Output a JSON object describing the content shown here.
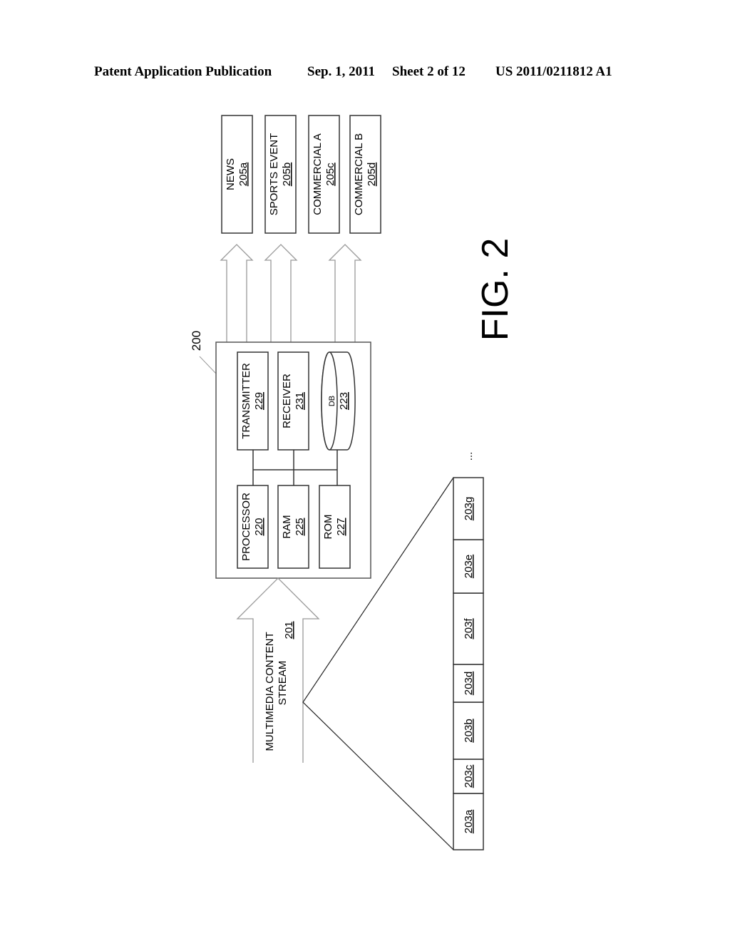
{
  "header": {
    "publication": "Patent Application Publication",
    "date": "Sep. 1, 2011",
    "sheet": "Sheet 2 of 12",
    "patent_number": "US 2011/0211812 A1"
  },
  "figure": {
    "label": "FIG. 2",
    "device": {
      "ref": "200",
      "components": [
        {
          "name": "TRANSMITTER",
          "ref": "229"
        },
        {
          "name": "RECEIVER",
          "ref": "231"
        },
        {
          "name": "DB",
          "ref": "223"
        },
        {
          "name": "PROCESSOR",
          "ref": "220"
        },
        {
          "name": "RAM",
          "ref": "225"
        },
        {
          "name": "ROM",
          "ref": "227"
        }
      ]
    },
    "input_stream": {
      "line1": "MULTIMEDIA CONTENT",
      "line2": "STREAM",
      "ref": "201"
    },
    "outputs": [
      {
        "name": "NEWS",
        "ref": "205a"
      },
      {
        "name": "SPORTS EVENT",
        "ref": "205b"
      },
      {
        "name": "COMMERCIAL A",
        "ref": "205c"
      },
      {
        "name": "COMMERCIAL B",
        "ref": "205d"
      }
    ],
    "segments": [
      "203a",
      "203c",
      "203b",
      "203d",
      "203f",
      "203e",
      "203g"
    ],
    "continuation": "..."
  }
}
